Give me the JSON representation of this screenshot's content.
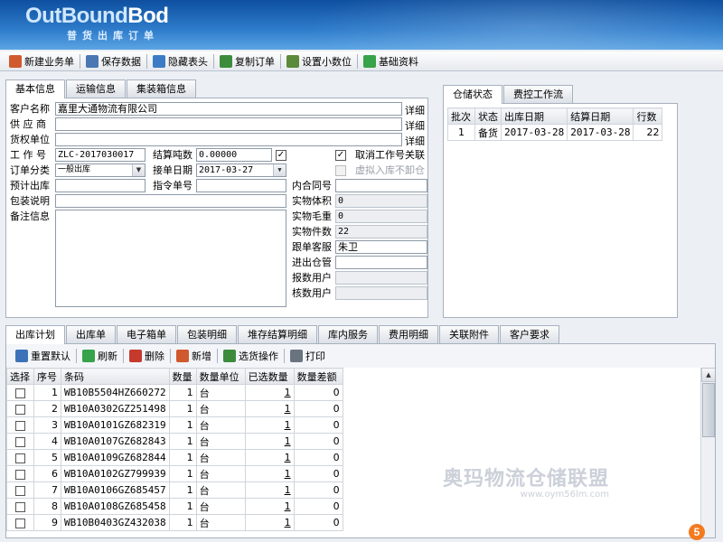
{
  "app": {
    "logo_outbound": "OutBound",
    "logo_bod": "Bod",
    "subtitle": "普货出库订单"
  },
  "toolbar": {
    "items": [
      {
        "label": "新建业务单",
        "icon": "pencil-icon",
        "color": "#D05A2E"
      },
      {
        "label": "保存数据",
        "icon": "save-icon",
        "color": "#4A76B4"
      },
      {
        "label": "隐藏表头",
        "icon": "table-icon",
        "color": "#3C7CC4"
      },
      {
        "label": "复制订单",
        "icon": "copy-icon",
        "color": "#3D8C3D"
      },
      {
        "label": "设置小数位",
        "icon": "settings-grid-icon",
        "color": "#5B8A3A"
      },
      {
        "label": "基础资料",
        "icon": "refresh-icon",
        "color": "#37A34A"
      }
    ]
  },
  "top_tabs": [
    "基本信息",
    "运输信息",
    "集装箱信息"
  ],
  "form": {
    "customer_label": "客户名称",
    "customer_value": "嘉里大通物流有限公司",
    "supplier_label": "供 应 商",
    "supplier_value": "",
    "owner_label": "货权单位",
    "owner_value": "",
    "detail_link": "详细",
    "job_no_label": "工 作 号",
    "job_no_value": "ZLC-2017030017",
    "order_type_label": "订单分类",
    "order_type_value": "一般出库",
    "plan_out_label": "预计出库",
    "plan_out_value": "",
    "pack_desc_label": "包装说明",
    "pack_desc_value": "",
    "remark_label": "备注信息",
    "remark_value": "",
    "settle_ton_label": "结算吨数",
    "settle_ton_value": "0.00000",
    "receive_date_label": "接单日期",
    "receive_date_value": "2017-03-27",
    "order_no_label": "指令单号",
    "order_no_value": "",
    "cancel_link_label": "取消工作号关联",
    "virtual_label": "虚拟入库不卸仓",
    "contract_label": "内合同号",
    "contract_value": "",
    "volume_label": "实物体积",
    "volume_value": "0",
    "gross_label": "实物毛重",
    "gross_value": "0",
    "pieces_label": "实物件数",
    "pieces_value": "22",
    "follower_label": "跟单客服",
    "follower_value": "朱卫",
    "warehouse_label": "进出仓管",
    "warehouse_value": "",
    "report_user_label": "报数用户",
    "report_user_value": "",
    "verify_user_label": "核数用户",
    "verify_user_value": ""
  },
  "right_tabs": [
    "仓储状态",
    "费控工作流"
  ],
  "status_table": {
    "headers": [
      "批次",
      "状态",
      "出库日期",
      "结算日期",
      "行数"
    ],
    "rows": [
      [
        "1",
        "备货",
        "2017-03-28",
        "2017-03-28",
        "22"
      ]
    ]
  },
  "bottom_tabs": [
    "出库计划",
    "出库单",
    "电子箱单",
    "包装明细",
    "堆存结算明细",
    "库内服务",
    "费用明细",
    "关联附件",
    "客户要求"
  ],
  "bottom_toolbar": [
    {
      "label": "重置默认",
      "icon": "home-icon",
      "color": "#3E72B8"
    },
    {
      "label": "刷新",
      "icon": "refresh-icon",
      "color": "#37A34A"
    },
    {
      "label": "删除",
      "icon": "delete-icon",
      "color": "#C63A2E"
    },
    {
      "label": "新增",
      "icon": "pencil-icon",
      "color": "#D05A2E"
    },
    {
      "label": "选货操作",
      "icon": "check-icon",
      "color": "#3D8C3D"
    },
    {
      "label": "打印",
      "icon": "printer-icon",
      "color": "#6A7480"
    }
  ],
  "plan_table": {
    "headers": [
      "选择",
      "序号",
      "条码",
      "数量",
      "数量单位",
      "已选数量",
      "数量差额"
    ],
    "rows": [
      [
        "1",
        "WB10B5504HZ660272",
        "1",
        "台",
        "1",
        "0"
      ],
      [
        "2",
        "WB10A0302GZ251498",
        "1",
        "台",
        "1",
        "0"
      ],
      [
        "3",
        "WB10A0101GZ682319",
        "1",
        "台",
        "1",
        "0"
      ],
      [
        "4",
        "WB10A0107GZ682843",
        "1",
        "台",
        "1",
        "0"
      ],
      [
        "5",
        "WB10A0109GZ682844",
        "1",
        "台",
        "1",
        "0"
      ],
      [
        "6",
        "WB10A0102GZ799939",
        "1",
        "台",
        "1",
        "0"
      ],
      [
        "7",
        "WB10A0106GZ685457",
        "1",
        "台",
        "1",
        "0"
      ],
      [
        "8",
        "WB10A0108GZ685458",
        "1",
        "台",
        "1",
        "0"
      ],
      [
        "9",
        "WB10B0403GZ432038",
        "1",
        "台",
        "1",
        "0"
      ]
    ]
  },
  "watermark": {
    "text": "奥玛物流仓储联盟",
    "url": "www.oym56lm.com"
  },
  "badge": "5"
}
